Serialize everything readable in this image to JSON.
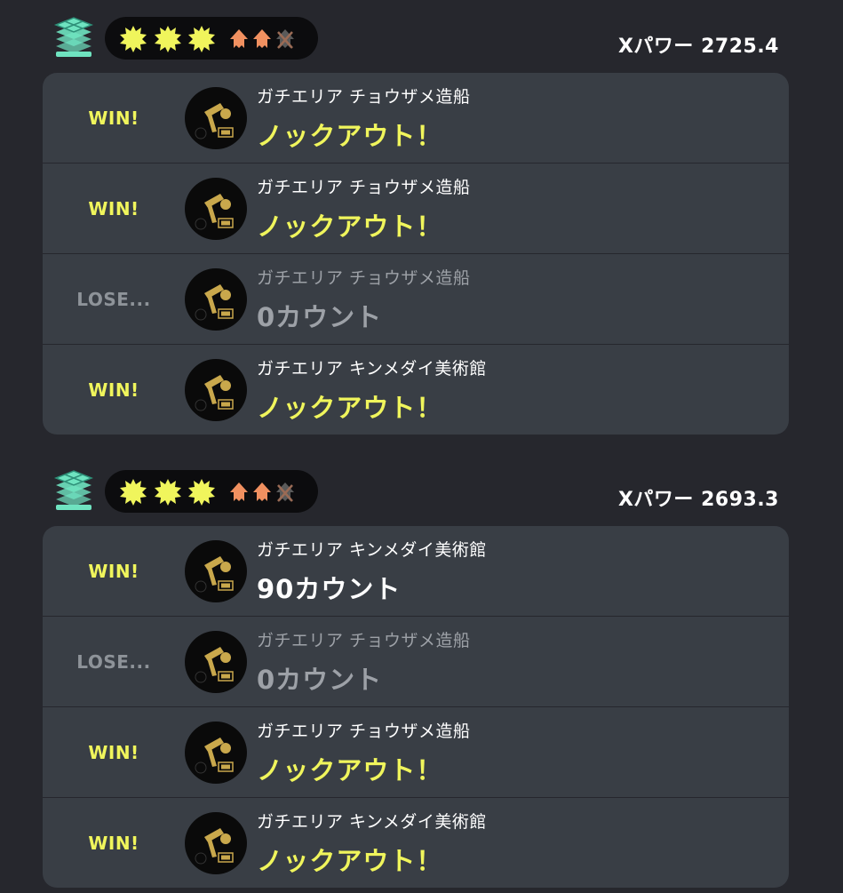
{
  "colors": {
    "background": "#26272d",
    "card": "#393e45",
    "win": "#f0f55c",
    "lose": "#8e9399",
    "splat": "#f0f55c",
    "squid_alive": "#f09060",
    "squid_dead": "#6b6b6b",
    "mode_icon": "#6fe3c0"
  },
  "icons": {
    "mode": "splat-zones-icon",
    "splat": "ink-splat-icon",
    "squid": "squid-icon",
    "weapon": "charger-weapon-icon"
  },
  "groups": [
    {
      "xpower": "Xパワー 2725.4",
      "splats": 3,
      "squids_alive": 2,
      "squids_dead": 1,
      "matches": [
        {
          "result": "WIN!",
          "outcome_type": "win",
          "stage": "ガチエリア チョウザメ造船",
          "outcome": "ノックアウト！",
          "style": "ko"
        },
        {
          "result": "WIN!",
          "outcome_type": "win",
          "stage": "ガチエリア チョウザメ造船",
          "outcome": "ノックアウト！",
          "style": "ko"
        },
        {
          "result": "LOSE...",
          "outcome_type": "lose",
          "stage": "ガチエリア チョウザメ造船",
          "outcome": "0カウント",
          "style": "zero"
        },
        {
          "result": "WIN!",
          "outcome_type": "win",
          "stage": "ガチエリア キンメダイ美術館",
          "outcome": "ノックアウト！",
          "style": "ko"
        }
      ]
    },
    {
      "xpower": "Xパワー 2693.3",
      "splats": 3,
      "squids_alive": 2,
      "squids_dead": 1,
      "matches": [
        {
          "result": "WIN!",
          "outcome_type": "win",
          "stage": "ガチエリア キンメダイ美術館",
          "outcome": "90カウント",
          "style": "count"
        },
        {
          "result": "LOSE...",
          "outcome_type": "lose",
          "stage": "ガチエリア チョウザメ造船",
          "outcome": "0カウント",
          "style": "zero"
        },
        {
          "result": "WIN!",
          "outcome_type": "win",
          "stage": "ガチエリア チョウザメ造船",
          "outcome": "ノックアウト！",
          "style": "ko"
        },
        {
          "result": "WIN!",
          "outcome_type": "win",
          "stage": "ガチエリア キンメダイ美術館",
          "outcome": "ノックアウト！",
          "style": "ko"
        }
      ]
    }
  ]
}
